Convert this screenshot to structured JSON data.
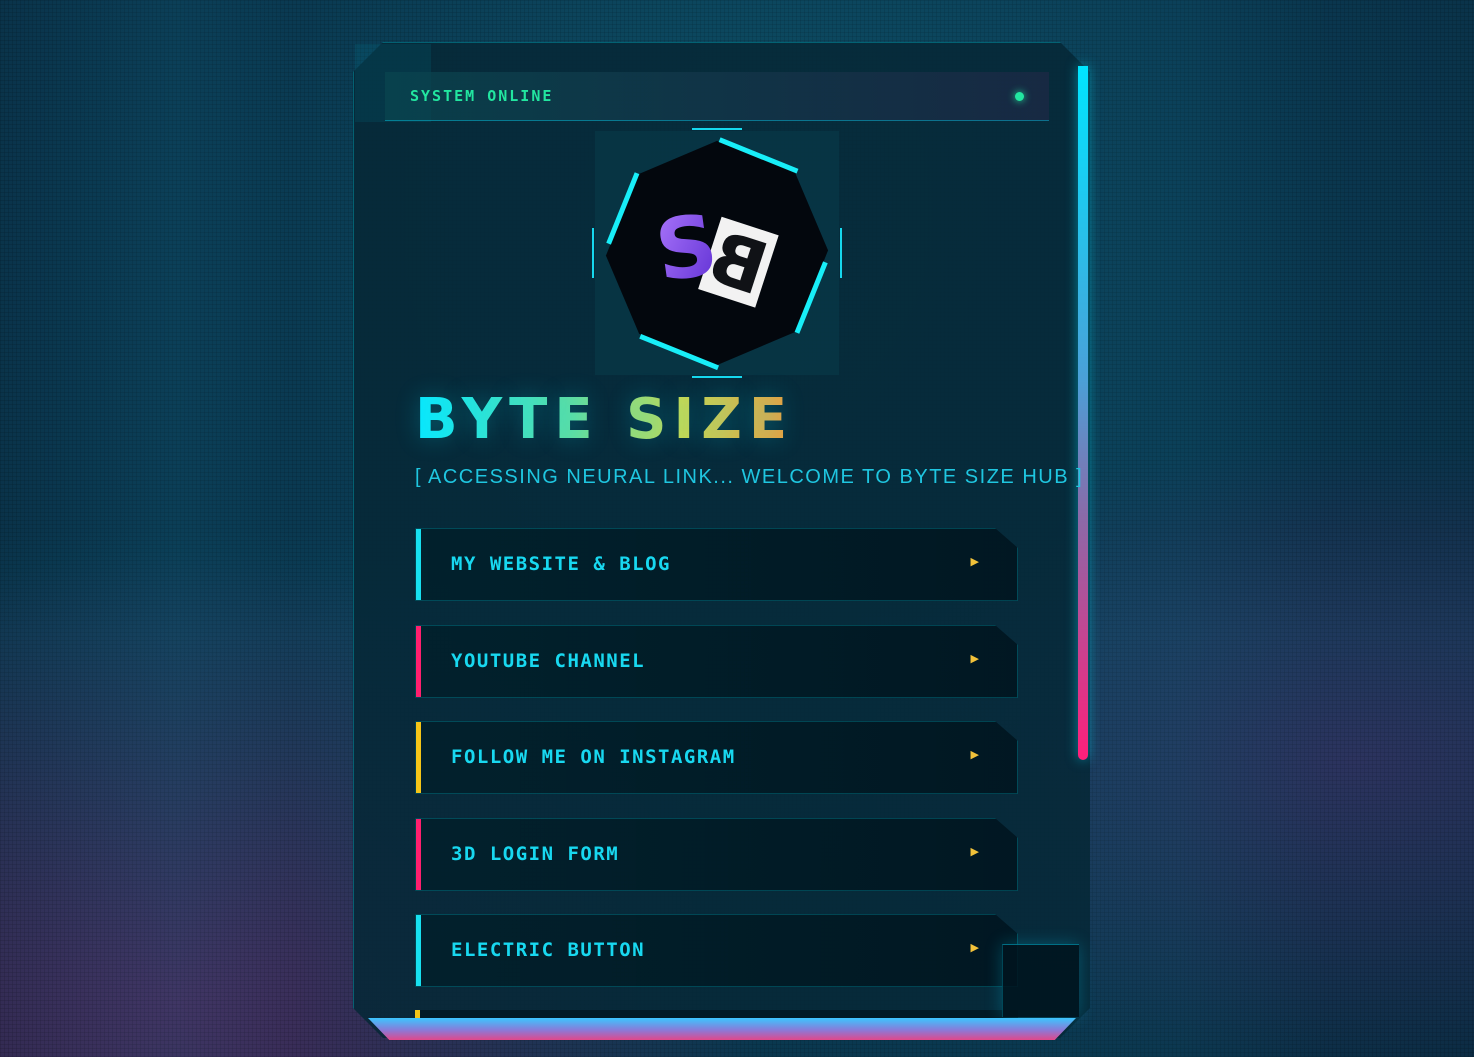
{
  "status": {
    "text": "SYSTEM ONLINE",
    "indicator": "online-dot"
  },
  "logo": {
    "letters": "SB"
  },
  "title": "BYTE SIZE",
  "subtitle": "[ ACCESSING NEURAL LINK... WELCOME TO BYTE SIZE HUB ]",
  "links": [
    {
      "label": "MY WEBSITE & BLOG",
      "accent": "#17e0f0",
      "icon": "play-arrow-icon"
    },
    {
      "label": "YOUTUBE CHANNEL",
      "accent": "#ff1f6e",
      "icon": "play-arrow-icon"
    },
    {
      "label": "FOLLOW ME ON INSTAGRAM",
      "accent": "#f5c518",
      "icon": "play-arrow-icon"
    },
    {
      "label": "3D LOGIN FORM",
      "accent": "#ff1f6e",
      "icon": "play-arrow-icon"
    },
    {
      "label": "ELECTRIC BUTTON",
      "accent": "#17e0f0",
      "icon": "play-arrow-icon"
    }
  ],
  "colors": {
    "cyan": "#17e0f0",
    "pink": "#ff1f6e",
    "yellow": "#f5c518",
    "green": "#22e6a0"
  }
}
